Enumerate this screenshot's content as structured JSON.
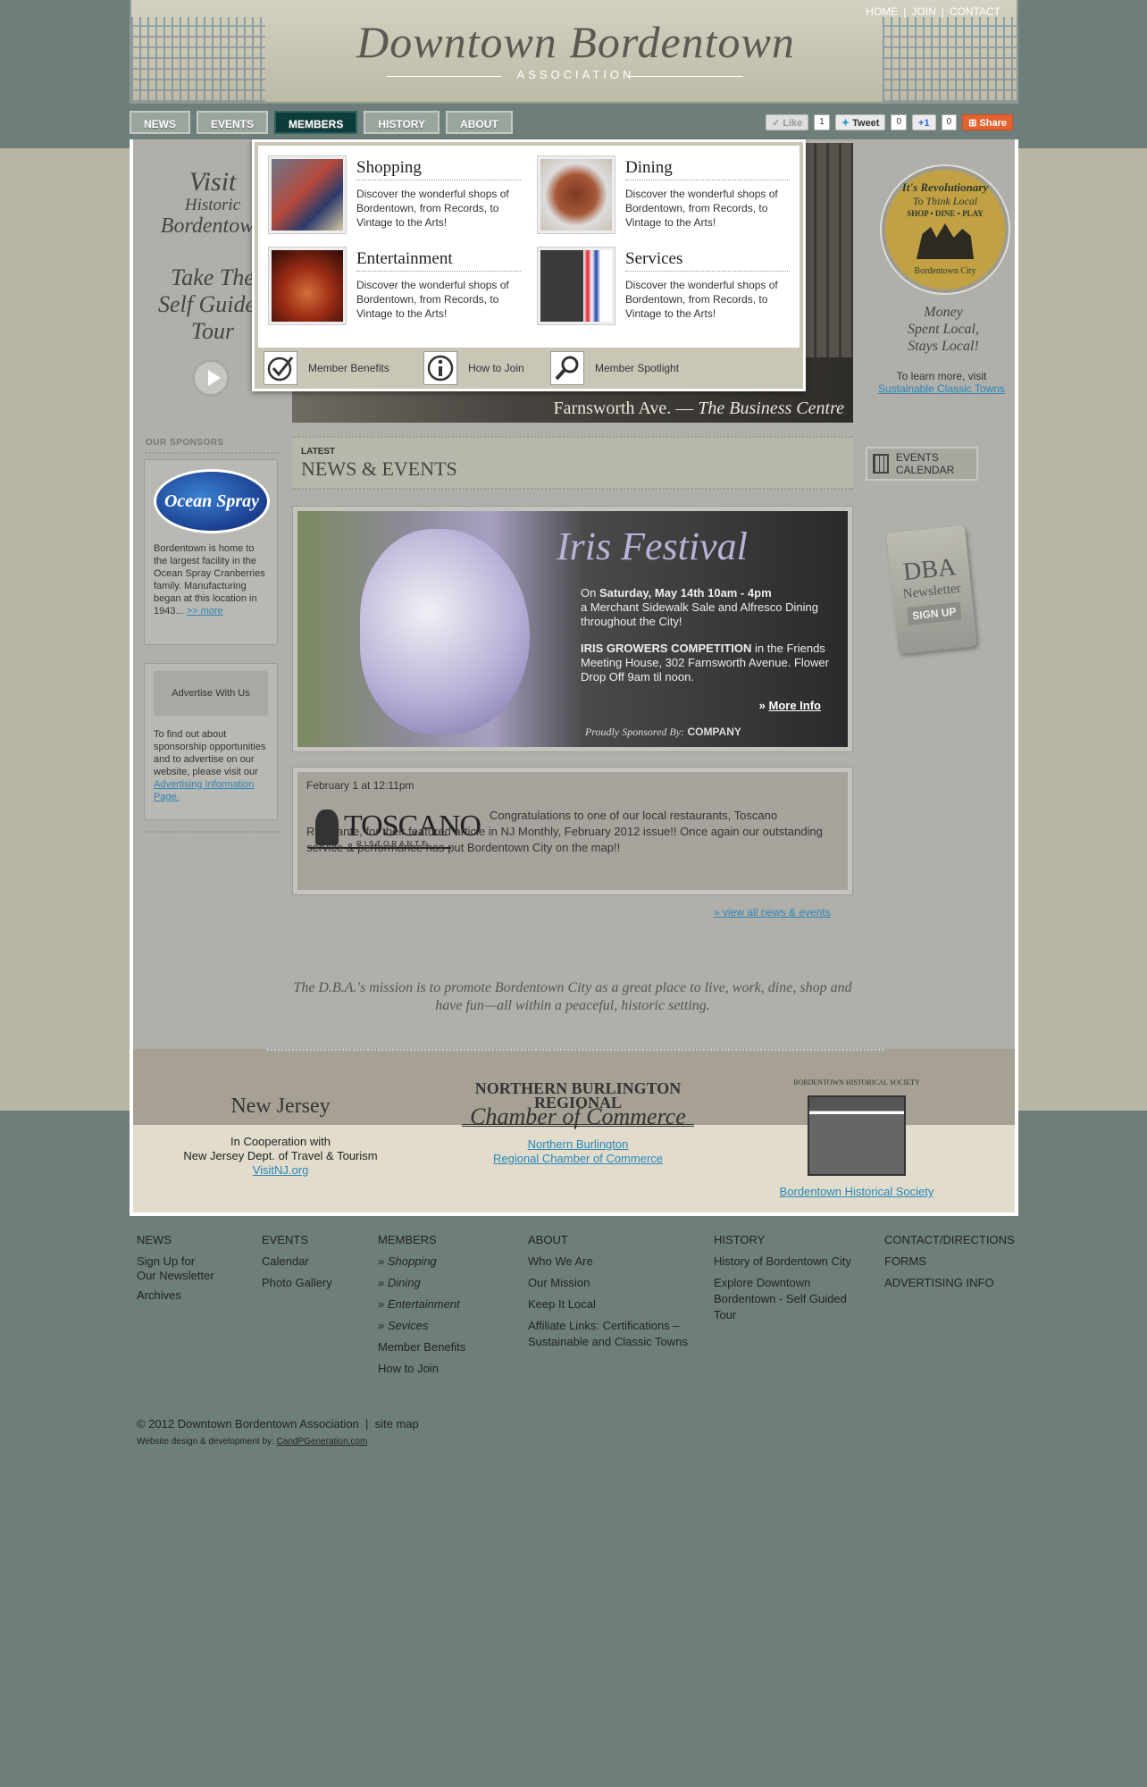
{
  "header": {
    "title": "Downtown Bordentown",
    "subtitle": "ASSOCIATION",
    "toplinks": [
      "HOME",
      "JOIN",
      "CONTACT"
    ]
  },
  "nav": {
    "items": [
      "NEWS",
      "EVENTS",
      "MEMBERS",
      "HISTORY",
      "ABOUT"
    ],
    "active": "MEMBERS"
  },
  "social": {
    "like_label": "Like",
    "like_count": "1",
    "tweet_label": "Tweet",
    "tweet_count": "0",
    "plusone_label": "+1",
    "plusone_count": "0",
    "share_label": "Share"
  },
  "dropdown": {
    "categories": [
      {
        "title": "Shopping",
        "desc": "Discover the wonderful shops of Bordentown, from Records, to Vintage to the Arts!"
      },
      {
        "title": "Dining",
        "desc": "Discover the wonderful shops of Bordentown, from Records, to Vintage to the Arts!"
      },
      {
        "title": "Entertainment",
        "desc": "Discover the wonderful shops of Bordentown, from Records, to Vintage to the Arts!"
      },
      {
        "title": "Services",
        "desc": "Discover the wonderful shops of Bordentown, from Records, to Vintage to the Arts!"
      }
    ],
    "links": [
      "Member Benefits",
      "How to Join",
      "Member Spotlight"
    ]
  },
  "left_promo": {
    "visit": "Visit",
    "historic": "Historic",
    "bordentown": "Bordentown",
    "take": "Take The",
    "self": "Self Guided",
    "tour": "Tour"
  },
  "hero": {
    "caption_a": "Farnsworth Ave. —",
    "caption_b": "The Business Centre"
  },
  "badge": {
    "line1": "It's Revolutionary",
    "line2": "To Think Local",
    "line3": "SHOP • DINE • PLAY",
    "line4": "Bordentown City"
  },
  "right": {
    "money": [
      "Money",
      "Spent Local,",
      "Stays Local!"
    ],
    "learn": "To learn more, visit",
    "learn_link": "Sustainable Classic Towns",
    "events_calendar": "EVENTS CALENDAR",
    "newsletter_a": "DBA",
    "newsletter_b": "Newsletter",
    "newsletter_c": "SIGN UP"
  },
  "sponsors": {
    "heading": "OUR SPONSORS",
    "logo": "Ocean Spray",
    "text": "Bordentown is home to the largest facility in the Ocean Spray Cranberries family. Manufacturing began at this location in 1943...",
    "more": ">> more",
    "advertise_btn": "Advertise With Us",
    "advertise_text": "To find out about sponsorship opportunities and to advertise on our website, please visit our",
    "advertise_link": "Advertising Information Page."
  },
  "news": {
    "latest": "LATEST",
    "heading": "NEWS & EVENTS",
    "iris_title": "Iris Festival",
    "iris_on": "On",
    "iris_date": "Saturday, May 14th 10am - 4pm",
    "iris_p1": "a Merchant Sidewalk Sale and Alfresco Dining throughout the City!",
    "iris_comp": "IRIS GROWERS COMPETITION",
    "iris_p2": "in the Friends Meeting House, 302 Farnsworth Avenue. Flower Drop Off 9am til noon.",
    "more_info": "More Info",
    "sponsored_by": "Proudly Sponsored By:",
    "sponsor": "COMPANY",
    "post_date": "February 1 at 12:11pm",
    "post_logo": "TOSCANO",
    "post_logo_sub": "RISTORANTE",
    "post_text": "Congratulations to one of our local restaurants, Toscano Ristorante, for their featured article in NJ Monthly, February 2012 issue!! Once again our outstanding service & performance has put Bordentown City on the map!!",
    "view_all": "» view all news & events"
  },
  "mission": "The D.B.A.'s mission is to promote Bordentown City as a great place to live, work, dine, shop and have fun—all within a peaceful, historic setting.",
  "partners": {
    "nj_logo": "New Jersey",
    "nj_line1": "In Cooperation with",
    "nj_line2": "New Jersey Dept. of Travel & Tourism",
    "nj_link": "VisitNJ.org",
    "coc_logo_a": "NORTHERN BURLINGTON REGIONAL",
    "coc_logo_b": "Chamber of Commerce",
    "coc_link_a": "Northern Burlington",
    "coc_link_b": "Regional Chamber of Commerce",
    "hs_logo": "BORDENTOWN HISTORICAL SOCIETY",
    "hs_link": "Bordentown Historical Society"
  },
  "footer": {
    "columns": [
      {
        "heading": "NEWS",
        "items": [
          "Sign Up for",
          "Our Newsletter",
          "Archives"
        ]
      },
      {
        "heading": "EVENTS",
        "items": [
          "Calendar",
          "Photo Gallery"
        ]
      },
      {
        "heading": "MEMBERS",
        "items": [
          "» Shopping",
          "» Dining",
          "» Entertainment",
          "» Sevices",
          "Member Benefits",
          "How to Join"
        ]
      },
      {
        "heading": "ABOUT",
        "items": [
          "Who We Are",
          "Our Mission",
          "Keep It Local",
          "Affiliate Links: Certifications –",
          "Sustainable and Classic Towns"
        ]
      },
      {
        "heading": "HISTORY",
        "items": [
          "History of Bordentown City",
          "Explore Downtown",
          "Bordentown - Self Guided",
          "Tour"
        ]
      },
      {
        "heading": "CONTACT/DIRECTIONS",
        "items": [
          "FORMS",
          "ADVERTISING INFO"
        ]
      }
    ],
    "copyright": "© 2012 Downtown Bordentown Association",
    "sitemap": "site map",
    "credit": "Website design & development by:",
    "credit_link": "CandPGeneration.com"
  }
}
